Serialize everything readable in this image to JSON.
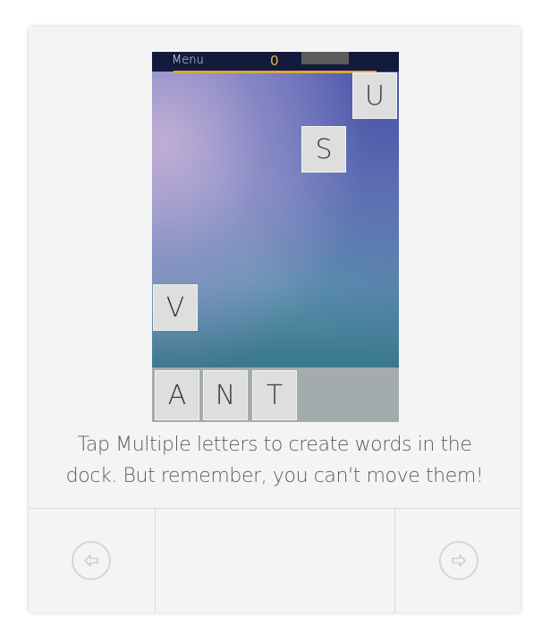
{
  "game": {
    "menu_label": "Menu",
    "score": "0",
    "board_tiles": [
      {
        "letter": "U"
      },
      {
        "letter": "S"
      },
      {
        "letter": "V"
      }
    ],
    "dock_tiles": [
      {
        "letter": "A"
      },
      {
        "letter": "N"
      },
      {
        "letter": "T"
      }
    ]
  },
  "caption": {
    "line1": "Tap Multiple letters to create words in the",
    "line2": "dock. But remember, you can't move them!"
  },
  "navigation": {
    "prev_icon": "arrow-left-circle-icon",
    "next_icon": "arrow-right-circle-icon"
  },
  "colors": {
    "score": "#e8b640",
    "timer_bar": "#d9a545",
    "top_bar": "#141a3c",
    "tile": "#dedede",
    "dock": "#a3abad"
  }
}
